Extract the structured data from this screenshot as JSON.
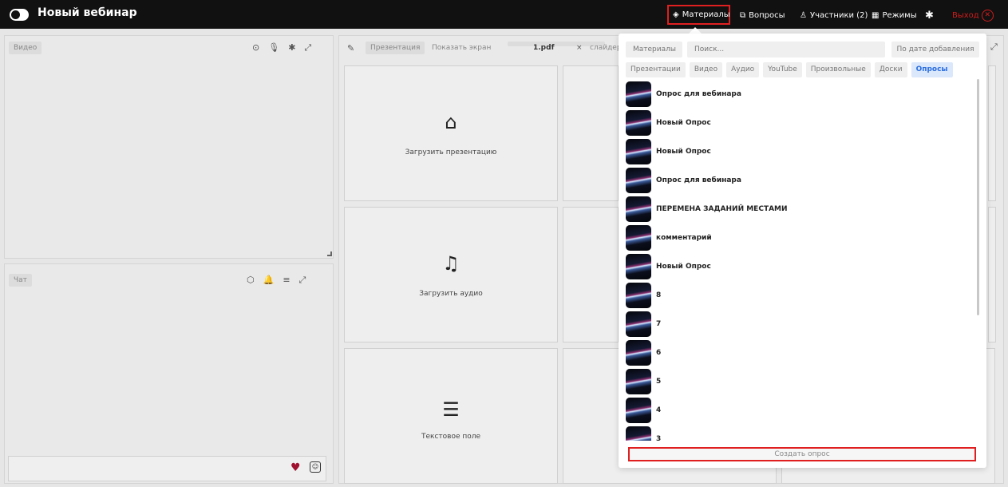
{
  "topbar": {
    "title": "Новый вебинар",
    "nav": {
      "materials": "Материалы",
      "questions": "Вопросы",
      "participants": "Участники (2)",
      "modes": "Режимы",
      "exit": "Выход"
    },
    "icons": [
      "toggle-icon",
      "layers-icon",
      "chat-bubbles-icon",
      "user-icon",
      "modes-icon",
      "gear-icon",
      "close-circle-icon"
    ]
  },
  "video_panel": {
    "label": "Видео"
  },
  "chat_panel": {
    "label": "Чат"
  },
  "presentation_panel": {
    "tabs": {
      "presentation": "Презентация",
      "show_screen": "Показать экран"
    },
    "file": "1.pdf",
    "close": "×",
    "slider_tab": "слайдер"
  },
  "cards": {
    "upload_presentation": "Загрузить презентацию",
    "upload_audio": "Загрузить аудио",
    "text_field": "Текстовое поле"
  },
  "dropdown": {
    "materials_label": "Материалы",
    "search_placeholder": "Поиск...",
    "sort": "По дате добавления",
    "filters": [
      "Презентации",
      "Видео",
      "Аудио",
      "YouTube",
      "Произвольные",
      "Доски",
      "Опросы"
    ],
    "active_filter": "Опросы",
    "polls": [
      "Опрос для вебинара",
      "Новый Опрос",
      "Новый Опрос",
      "Опрос для вебинара",
      "ПЕРЕМЕНА ЗАДАНИЙ МЕСТАМИ",
      "комментарий",
      "Новый Опрос",
      "8",
      "7",
      "6",
      "5",
      "4",
      "3"
    ],
    "create_button": "Создать опрос"
  },
  "colors": {
    "accent_red": "#e02020",
    "active_filter_blue": "#2a6de0",
    "heart": "#a0102f"
  }
}
